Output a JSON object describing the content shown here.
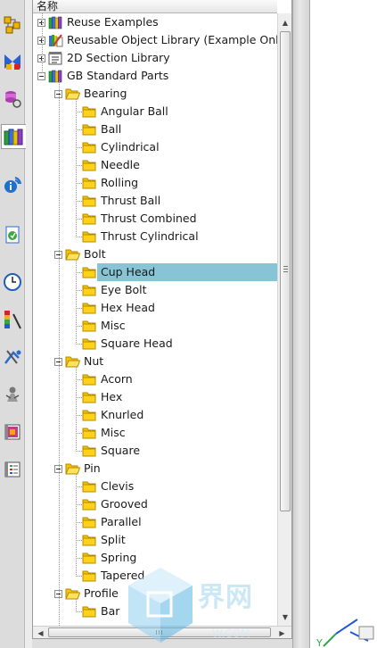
{
  "panel": {
    "column_header": "名称"
  },
  "tree": {
    "roots": [
      {
        "label": "Reuse Examples",
        "icon": "books-icon"
      },
      {
        "label": "Reusable Object Library (Example Only)",
        "icon": "library-edit-icon"
      },
      {
        "label": "2D Section Library",
        "icon": "section-library-icon"
      },
      {
        "label": "GB Standard Parts",
        "icon": "books-icon"
      }
    ],
    "groups": [
      {
        "label": "Bearing",
        "children": [
          "Angular Ball",
          "Ball",
          "Cylindrical",
          "Needle",
          "Rolling",
          "Thrust Ball",
          "Thrust Combined",
          "Thrust Cylindrical"
        ]
      },
      {
        "label": "Bolt",
        "children": [
          "Cup Head",
          "Eye Bolt",
          "Hex Head",
          "Misc",
          "Square Head"
        ]
      },
      {
        "label": "Nut",
        "children": [
          "Acorn",
          "Hex",
          "Knurled",
          "Misc",
          "Square"
        ]
      },
      {
        "label": "Pin",
        "children": [
          "Clevis",
          "Grooved",
          "Parallel",
          "Split",
          "Spring",
          "Tapered"
        ]
      },
      {
        "label": "Profile",
        "children": [
          "Bar"
        ]
      }
    ],
    "selected_item": "Cup Head"
  },
  "resource_bar": {
    "icons": [
      "assembly-navigator-icon",
      "constraint-navigator-icon",
      "part-navigator-icon",
      "reuse-library-icon",
      "web-browser-icon",
      "history-icon",
      "clock-icon",
      "visualization-icon",
      "process-studio-icon",
      "role-icon",
      "palette-icon",
      "system-materials-icon"
    ],
    "active": "reuse-library-icon"
  },
  "watermark": {
    "text": "界网",
    "sub_text": "W.COM"
  },
  "colors": {
    "selection": "#86c4d6",
    "folder": "#f5c400",
    "folder_edge": "#b88a00"
  }
}
